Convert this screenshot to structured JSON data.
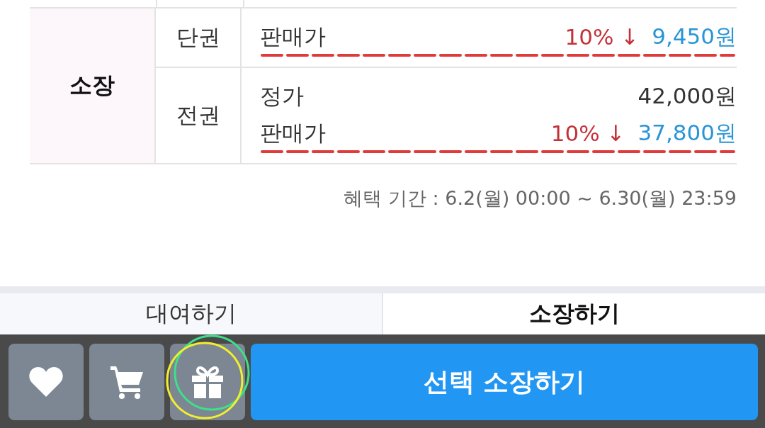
{
  "price_table": {
    "group_label": "소장",
    "rows": [
      {
        "volume": "단권",
        "lines": [
          {
            "kind": "sale",
            "label": "판매가",
            "discount": "10% ↓",
            "price": "9,450원",
            "underlined": true
          }
        ]
      },
      {
        "volume": "전권",
        "lines": [
          {
            "kind": "regular",
            "label": "정가",
            "price": "42,000원",
            "underlined": false
          },
          {
            "kind": "sale",
            "label": "판매가",
            "discount": "10% ↓",
            "price": "37,800원",
            "underlined": true
          }
        ]
      }
    ]
  },
  "benefit_period": "혜택 기간 : 6.2(월) 00:00 ~ 6.30(월) 23:59",
  "tabs": [
    {
      "label": "대여하기",
      "selected": false
    },
    {
      "label": "소장하기",
      "selected": true
    }
  ],
  "action_bar": {
    "icon_buttons": [
      {
        "kind": "heart",
        "circled": false
      },
      {
        "kind": "cart",
        "circled": false
      },
      {
        "kind": "gift",
        "circled": true
      }
    ],
    "primary_button": "선택 소장하기"
  }
}
